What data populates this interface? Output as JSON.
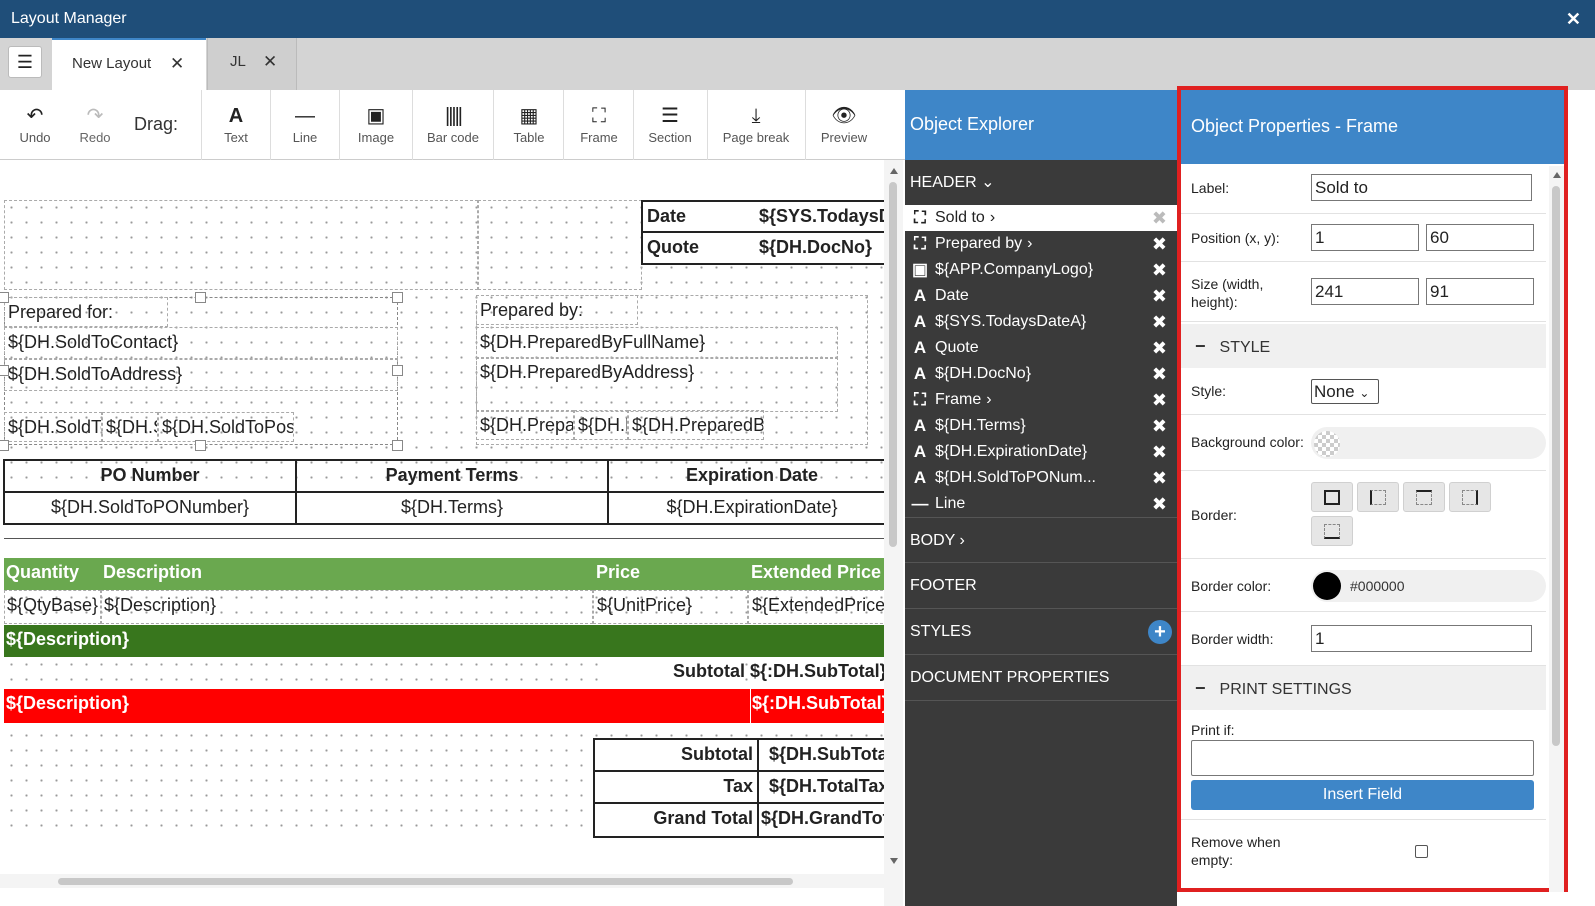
{
  "window": {
    "title": "Layout Manager",
    "close": "✕"
  },
  "tabs": [
    {
      "label": "New Layout",
      "close": "✕"
    },
    {
      "label": "JL",
      "close": "✕"
    }
  ],
  "menu_icon": "☰",
  "toolbar": {
    "undo": "Undo",
    "redo": "Redo",
    "drag": "Drag:",
    "text": "Text",
    "line": "Line",
    "image": "Image",
    "barcode": "Bar code",
    "table": "Table",
    "frame": "Frame",
    "section": "Section",
    "pagebreak": "Page break",
    "preview": "Preview"
  },
  "canvas": {
    "date_label": "Date",
    "date_value": "${SYS.TodaysDateA}",
    "quote_label": "Quote",
    "quote_value": "${DH.DocNo}",
    "prepared_for": "Prepared for:",
    "sold_contact": "${DH.SoldToContact}",
    "sold_address": "${DH.SoldToAddress}",
    "sold_c1": "${DH.SoldToCity}",
    "sold_c2": "${DH.SoldToState}",
    "sold_c3": "${DH.SoldToPostalCode}",
    "prepared_by": "Prepared by:",
    "prep_name": "${DH.PreparedByFullName}",
    "prep_address": "${DH.PreparedByAddress}",
    "prep_c1": "${DH.PreparedByCity}",
    "prep_c2": "${DH.PreparedByState}",
    "prep_c3": "${DH.PreparedByPostalCode}",
    "po_header": "PO Number",
    "terms_header": "Payment Terms",
    "exp_header": "Expiration Date",
    "po_value": "${DH.SoldToPONumber}",
    "terms_value": "${DH.Terms}",
    "exp_value": "${DH.ExpirationDate}",
    "qty_header": "Quantity",
    "desc_header": "Description",
    "price_header": "Price",
    "ext_header": "Extended Price",
    "qty_value": "${QtyBase}",
    "desc_value": "${Description}",
    "price_value": "${UnitPrice}",
    "ext_value": "${ExtendedPrice}",
    "group_desc": "${Description}",
    "subtotal_label": "Subtotal",
    "subtotal_value": "${:DH.SubTotal}",
    "red_desc": "${Description}",
    "red_value": "${:DH.SubTotal}",
    "sum_subtotal_label": "Subtotal",
    "sum_subtotal_value": "${DH.SubTotal}",
    "sum_tax_label": "Tax",
    "sum_tax_value": "${DH.TotalTax}",
    "sum_grand_label": "Grand Total",
    "sum_grand_value": "${DH.GrandTotal}"
  },
  "explorer": {
    "title": "Object Explorer",
    "header_label": "HEADER",
    "items": [
      {
        "icon": "frame-icon",
        "glyph": "⛶",
        "label": "Sold to",
        "arrow": "›",
        "selected": true
      },
      {
        "icon": "frame-icon",
        "glyph": "⛶",
        "label": "Prepared by",
        "arrow": "›"
      },
      {
        "icon": "image-icon",
        "glyph": "▣",
        "label": "${APP.CompanyLogo}",
        "arrow": ""
      },
      {
        "icon": "text-icon",
        "glyph": "A",
        "label": "Date",
        "arrow": ""
      },
      {
        "icon": "text-icon",
        "glyph": "A",
        "label": "${SYS.TodaysDateA}",
        "arrow": ""
      },
      {
        "icon": "text-icon",
        "glyph": "A",
        "label": "Quote",
        "arrow": ""
      },
      {
        "icon": "text-icon",
        "glyph": "A",
        "label": "${DH.DocNo}",
        "arrow": ""
      },
      {
        "icon": "frame-icon",
        "glyph": "⛶",
        "label": "Frame",
        "arrow": "›"
      },
      {
        "icon": "text-icon",
        "glyph": "A",
        "label": "${DH.Terms}",
        "arrow": ""
      },
      {
        "icon": "text-icon",
        "glyph": "A",
        "label": "${DH.ExpirationDate}",
        "arrow": ""
      },
      {
        "icon": "text-icon",
        "glyph": "A",
        "label": "${DH.SoldToPONum...",
        "arrow": ""
      },
      {
        "icon": "line-icon",
        "glyph": "—",
        "label": "Line",
        "arrow": ""
      }
    ],
    "body_label": "BODY",
    "footer_label": "FOOTER",
    "styles_label": "STYLES",
    "docprops_label": "DOCUMENT PROPERTIES"
  },
  "props": {
    "title": "Object Properties - Frame",
    "label_label": "Label:",
    "label_value": "Sold to",
    "pos_label": "Position (x, y):",
    "pos_x": "1",
    "pos_y": "60",
    "size_label": "Size (width, height):",
    "size_w": "241",
    "size_h": "91",
    "style_section": "STYLE",
    "collapse": "−",
    "style_label": "Style:",
    "style_value": "None",
    "bg_label": "Background color:",
    "border_label": "Border:",
    "border_color_label": "Border color:",
    "border_color_value": "#000000",
    "border_width_label": "Border width:",
    "border_width_value": "1",
    "print_section": "PRINT SETTINGS",
    "print_if_label": "Print if:",
    "insert_field": "Insert Field",
    "remove_label": "Remove when empty:"
  },
  "colors": {
    "accent": "#3e86c8",
    "green": "#6aa84f",
    "darkgreen": "#38761d",
    "red": "#ff0000",
    "highlight": "#e02020"
  }
}
